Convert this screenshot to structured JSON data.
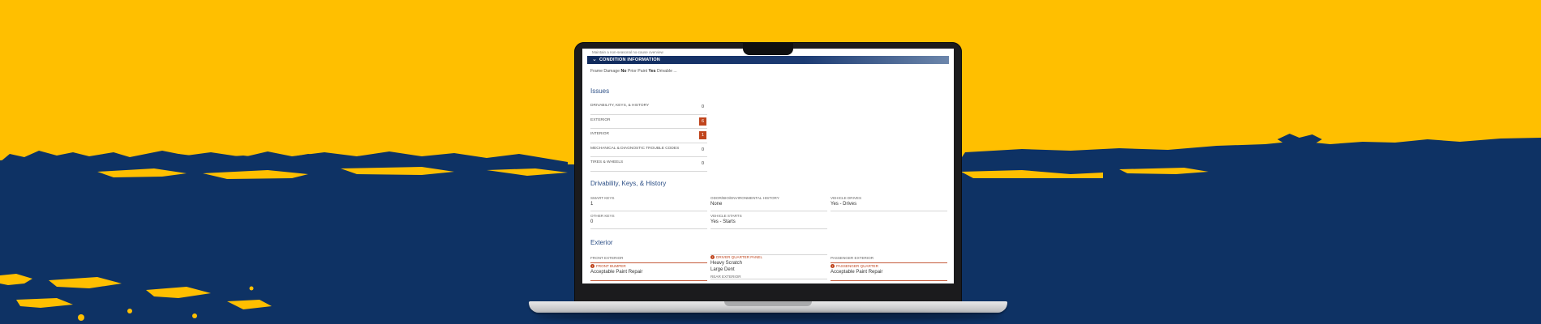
{
  "colors": {
    "brand_yellow": "#FFBF00",
    "brand_navy": "#0E3264",
    "alert": "#C0451D",
    "section_bar": "#102A5C"
  },
  "screen": {
    "top_note": "Maintain a non-seasonal no-cause overview",
    "section_title": "CONDITION INFORMATION",
    "section_icon": "chevron-down-icon",
    "filter": {
      "prefix": "Frame Damage",
      "frame_value": "No",
      "mid": "Prior Paint",
      "paint_value": "Yes",
      "suffix": "Drivable ..."
    },
    "issues": {
      "heading": "Issues",
      "items": [
        {
          "label": "DRIVABILITY, KEYS, & HISTORY",
          "count": "0",
          "alert": false
        },
        {
          "label": "EXTERIOR",
          "count": "6",
          "alert": true
        },
        {
          "label": "INTERIOR",
          "count": "1",
          "alert": true
        },
        {
          "label": "MECHANICAL & DIAGNOSTIC TROUBLE CODES",
          "count": "0",
          "alert": false
        },
        {
          "label": "TIRES & WHEELS",
          "count": "0",
          "alert": false
        }
      ]
    },
    "drivability": {
      "heading": "Drivability, Keys, & History",
      "smart_keys": {
        "label": "SMART KEYS",
        "value": "1"
      },
      "odor": {
        "label": "ODOR/BIO/ENVIRONMENTAL HISTORY",
        "value": "None"
      },
      "drives": {
        "label": "VEHICLE DRIVES",
        "value": "Yes - Drives"
      },
      "other_keys": {
        "label": "OTHER KEYS",
        "value": "0"
      },
      "starts": {
        "label": "VEHICLE STARTS",
        "value": "Yes - Starts"
      }
    },
    "exterior": {
      "heading": "Exterior",
      "front": {
        "label": "FRONT EXTERIOR",
        "sub_label": "FRONT BUMPER",
        "sub_value": "Acceptable Paint Repair"
      },
      "driver": {
        "label": "DRIVER QUARTER PANEL",
        "value1": "Heavy Scratch",
        "value2": "Large Dent",
        "next_label": "REAR EXTERIOR"
      },
      "passenger": {
        "label": "PASSENGER EXTERIOR",
        "sub_label": "PASSENGER QUARTER",
        "sub_value": "Acceptable Paint Repair"
      }
    }
  }
}
